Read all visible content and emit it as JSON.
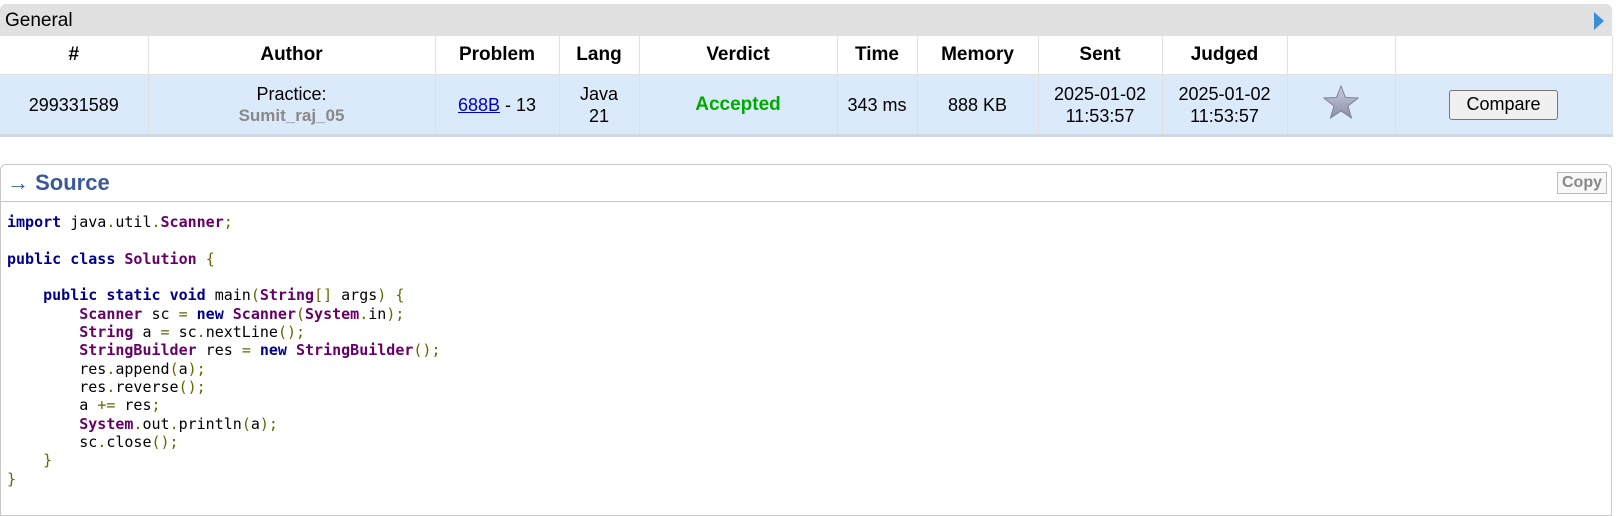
{
  "general": {
    "title": "General"
  },
  "table": {
    "headers": [
      "#",
      "Author",
      "Problem",
      "Lang",
      "Verdict",
      "Time",
      "Memory",
      "Sent",
      "Judged",
      "",
      ""
    ],
    "row": {
      "id": "299331589",
      "author_prefix": "Practice:",
      "author_name": "Sumit_raj_05",
      "problem_link": "688B",
      "problem_suffix": " - 13",
      "lang_line1": "Java",
      "lang_line2": "21",
      "verdict": "Accepted",
      "time": "343 ms",
      "memory": "888 KB",
      "sent_date": "2025-01-02",
      "sent_time": "11:53:57",
      "judged_date": "2025-01-02",
      "judged_time": "11:53:57",
      "compare_label": "Compare"
    }
  },
  "source": {
    "title": "→ Source",
    "copy_label": "Copy",
    "code_lines": [
      "import java.util.Scanner;",
      "",
      "public class Solution {",
      "",
      "    public static void main(String[] args) {",
      "        Scanner sc = new Scanner(System.in);",
      "        String a = sc.nextLine();",
      "        StringBuilder res = new StringBuilder();",
      "        res.append(a);",
      "        res.reverse();",
      "        a += res;",
      "        System.out.println(a);",
      "        sc.close();",
      "    }",
      "}"
    ]
  },
  "colors": {
    "accepted": "#00aa00",
    "row_bg": "#dbeafb",
    "link": "#0000cc",
    "source_title": "#3b5998"
  }
}
